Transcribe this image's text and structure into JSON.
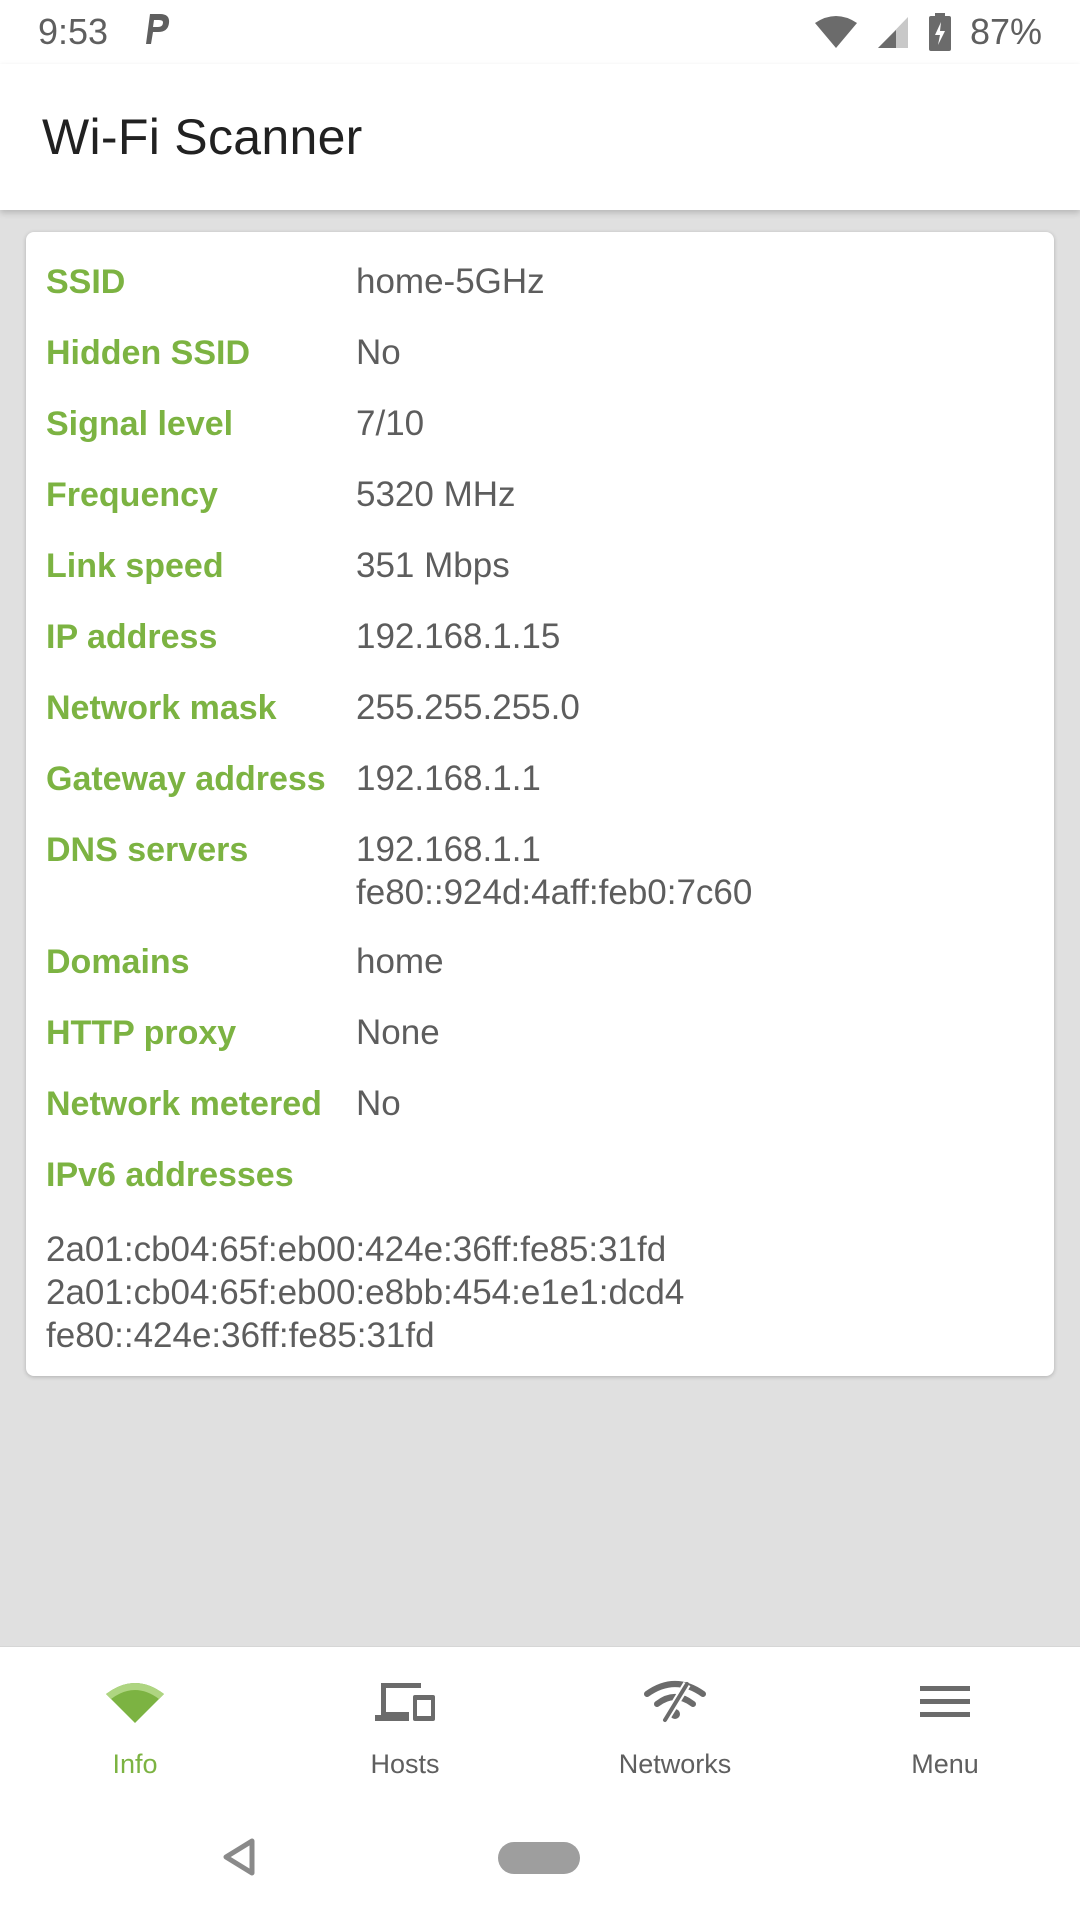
{
  "status_bar": {
    "time": "9:53",
    "notification_icon": "parking-icon",
    "battery_percent": "87%"
  },
  "app_bar": {
    "title": "Wi-Fi Scanner"
  },
  "info_card": {
    "rows": [
      {
        "label": "SSID",
        "value": "home-5GHz"
      },
      {
        "label": "Hidden SSID",
        "value": "No"
      },
      {
        "label": "Signal level",
        "value": "7/10"
      },
      {
        "label": "Frequency",
        "value": "5320 MHz"
      },
      {
        "label": "Link speed",
        "value": "351 Mbps"
      },
      {
        "label": "IP address",
        "value": "192.168.1.15"
      },
      {
        "label": "Network mask",
        "value": "255.255.255.0"
      },
      {
        "label": "Gateway address",
        "value": "192.168.1.1"
      },
      {
        "label": "DNS servers",
        "values": [
          "192.168.1.1",
          "fe80::924d:4aff:feb0:7c60"
        ]
      },
      {
        "label": "Domains",
        "value": "home"
      },
      {
        "label": "HTTP proxy",
        "value": "None"
      },
      {
        "label": "Network metered",
        "value": "No"
      }
    ],
    "ipv6_label": "IPv6 addresses",
    "ipv6_addresses": [
      "2a01:cb04:65f:eb00:424e:36ff:fe85:31fd",
      "2a01:cb04:65f:eb00:e8bb:454:e1e1:dcd4",
      "fe80::424e:36ff:fe85:31fd"
    ]
  },
  "bottom_nav": {
    "items": [
      {
        "label": "Info",
        "icon": "wifi-signal-icon",
        "active": true
      },
      {
        "label": "Hosts",
        "icon": "devices-icon",
        "active": false
      },
      {
        "label": "Networks",
        "icon": "wifi-off-icon",
        "active": false
      },
      {
        "label": "Menu",
        "icon": "menu-icon",
        "active": false
      }
    ]
  },
  "colors": {
    "accent": "#7cb342",
    "label_text": "#7cb342",
    "value_text": "#5d5d5d",
    "background": "#e0e0e0"
  }
}
